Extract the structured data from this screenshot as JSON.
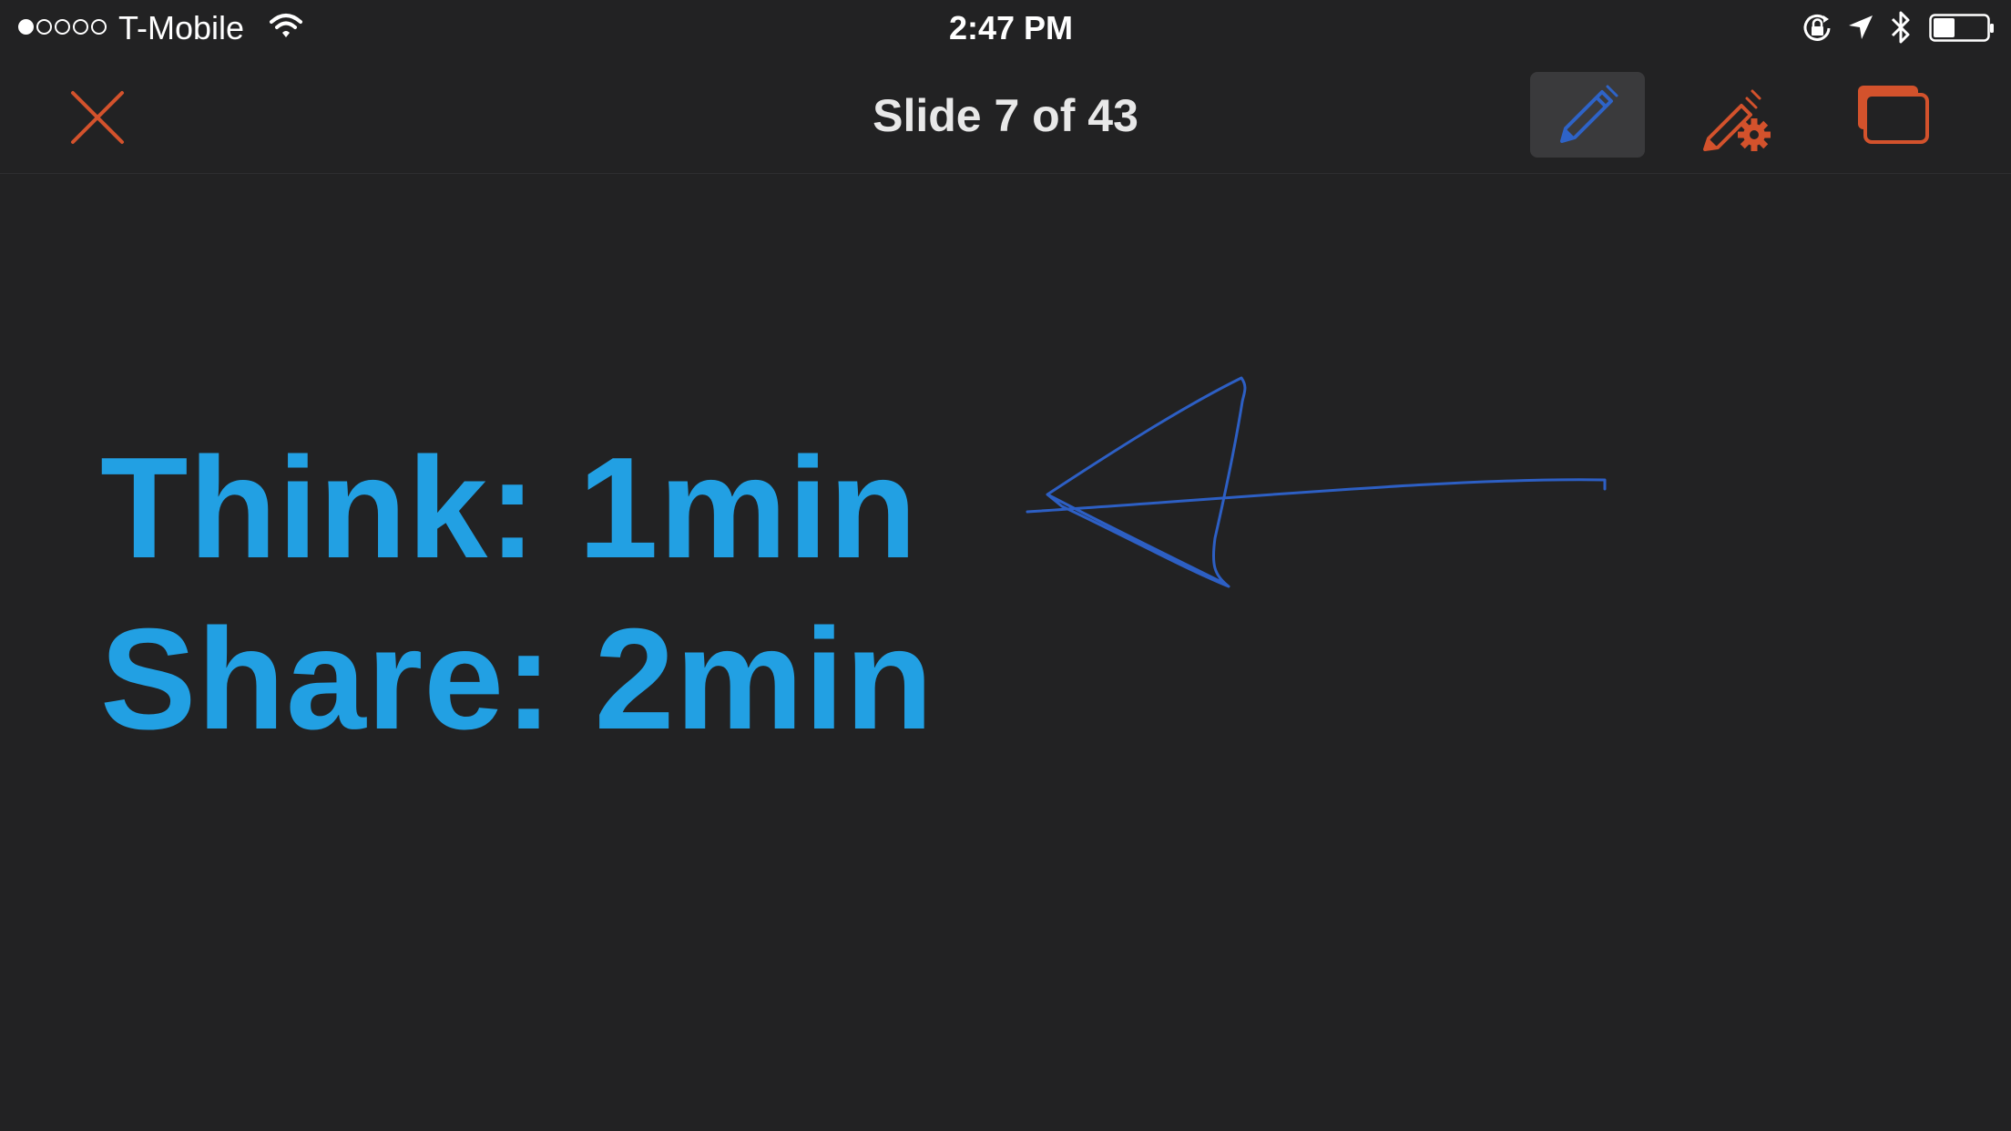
{
  "status_bar": {
    "signal_dots": [
      true,
      false,
      false,
      false,
      false
    ],
    "carrier": "T-Mobile",
    "time": "2:47 PM",
    "icons": [
      "wifi-icon",
      "lock-rotation-icon",
      "location-arrow-icon",
      "bluetooth-icon",
      "battery-icon"
    ],
    "battery_level": 0.4
  },
  "toolbar": {
    "title": "Slide 7 of 43",
    "buttons": [
      "close-icon",
      "pen-icon",
      "pen-settings-icon",
      "slides-icon"
    ],
    "active_tool": "pen",
    "accent_color": "#d3522c"
  },
  "slide": {
    "lines": [
      "Think: 1min",
      "Share: 2min"
    ],
    "text_color": "#22a0e3",
    "annotation_color": "#2d5fc4",
    "background_color": "#222223"
  }
}
